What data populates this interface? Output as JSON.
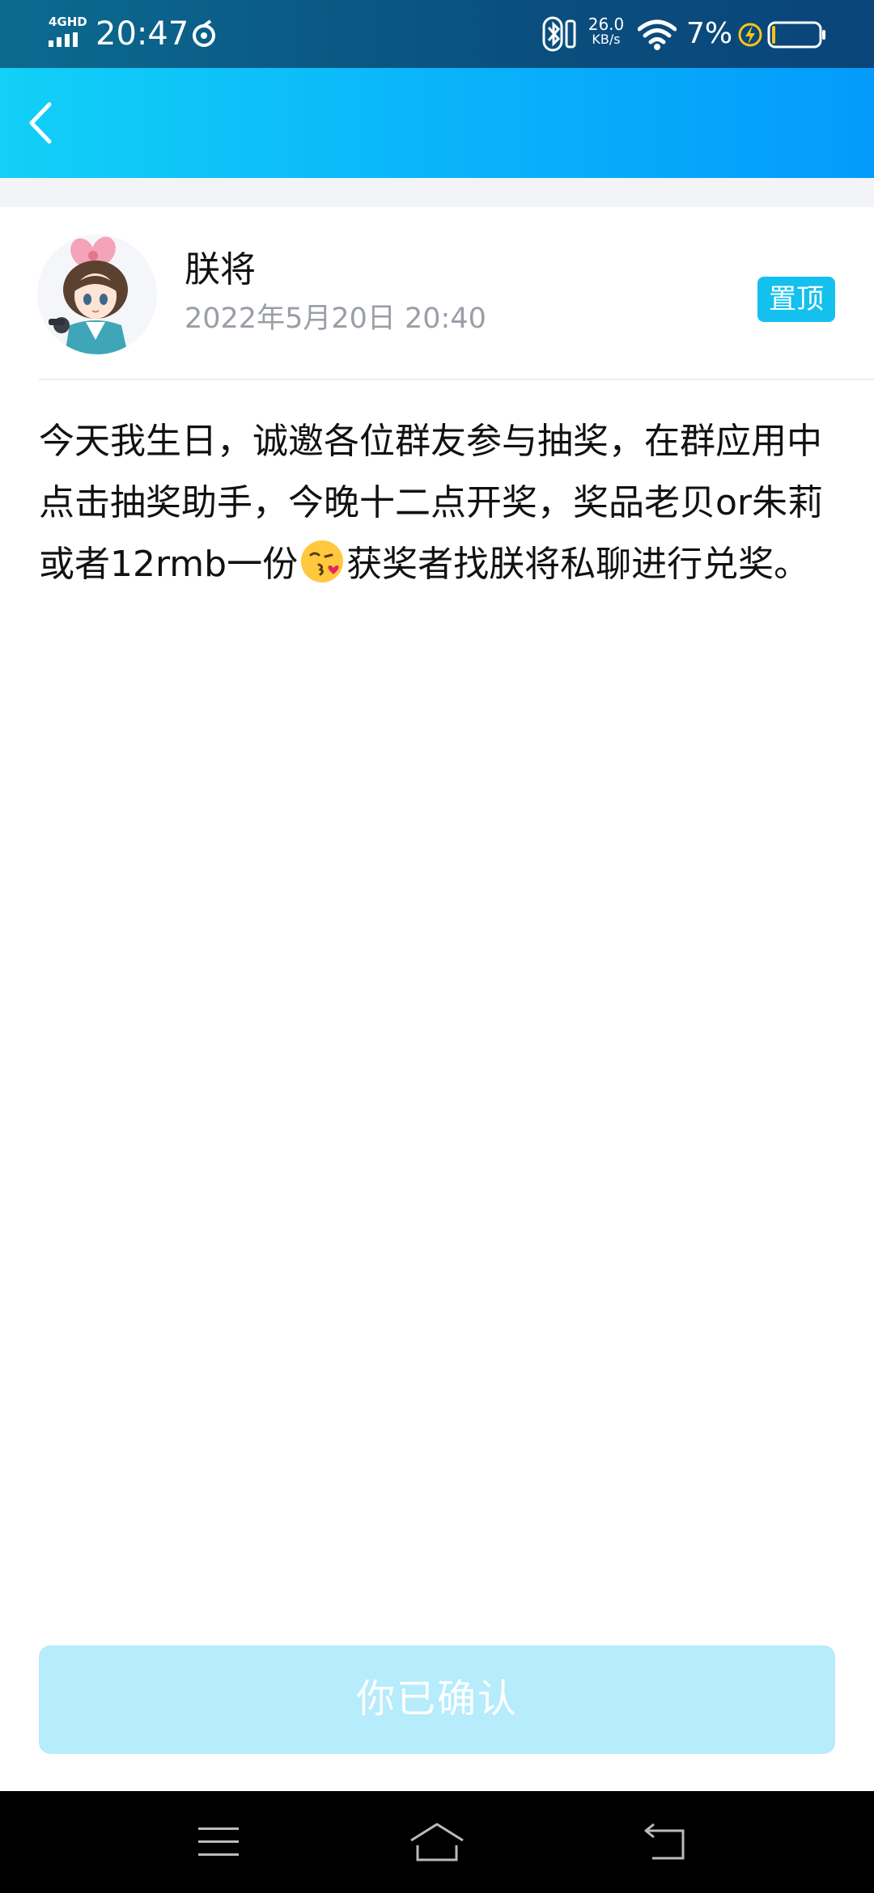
{
  "status_bar": {
    "network": "4GHD",
    "time": "20:47",
    "speed_value": "26.0",
    "speed_unit": "KB/s",
    "battery_percent": "7%",
    "icons": [
      "signal-icon",
      "sync-icon",
      "bluetooth-icon",
      "wifi-icon",
      "charging-icon",
      "battery-icon"
    ]
  },
  "header": {
    "back_icon": "chevron-left-icon"
  },
  "post": {
    "author_name": "朕将",
    "date": "2022年5月20日 20:40",
    "pin_label": "置顶",
    "content_part1": "今天我生日，诚邀各位群友参与抽奖，在群应用中点击抽奖助手，今晚十二点开奖，奖品老贝or朱莉或者12rmb一份",
    "emoji": "kissing-face-emoji",
    "content_part2": "获奖者找朕将私聊进行兑奖。"
  },
  "confirm_button": {
    "label": "你已确认"
  },
  "nav_bar": {
    "icons": [
      "menu-icon",
      "home-icon",
      "back-icon"
    ]
  },
  "colors": {
    "header_start": "#12d0f7",
    "header_end": "#039bfb",
    "pin_badge": "#14c0ee",
    "confirm_disabled": "#b6ecfb",
    "date_gray": "#9a9ea6"
  }
}
